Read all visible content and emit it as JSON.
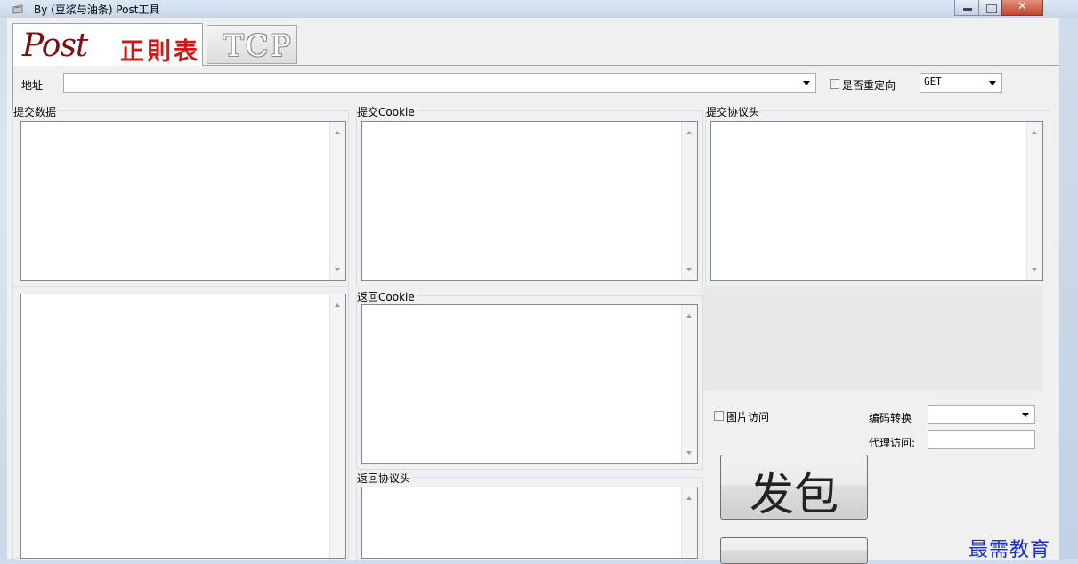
{
  "window": {
    "title": "By (豆浆与油条) Post工具"
  },
  "tabs": [
    {
      "label": "Post",
      "subtitle": "正則表"
    },
    {
      "label": "TCP"
    }
  ],
  "address": {
    "label": "地址",
    "value": ""
  },
  "redirect": {
    "label": "是否重定向",
    "checked": false
  },
  "method": {
    "value": "GET"
  },
  "groups": {
    "submit_data": "提交数据",
    "submit_cookie": "提交Cookie",
    "submit_headers": "提交协议头",
    "return_cookie": "返回Cookie",
    "return_headers": "返回协议头"
  },
  "options": {
    "image_access": {
      "label": "图片访问",
      "checked": false
    },
    "encoding": {
      "label": "编码转换",
      "value": ""
    },
    "proxy": {
      "label": "代理访问:",
      "value": ""
    }
  },
  "send_button": {
    "label": "发包"
  },
  "watermark": "最需教育"
}
